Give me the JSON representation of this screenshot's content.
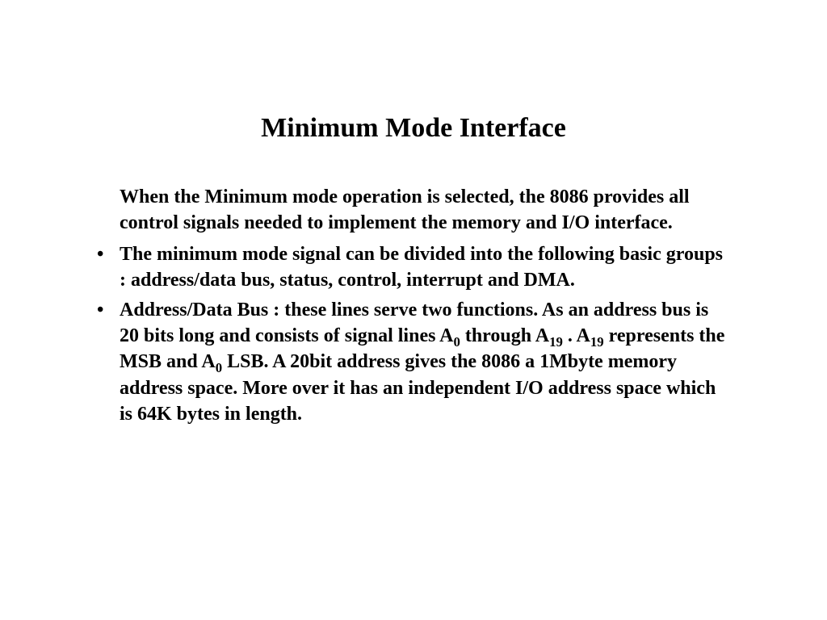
{
  "title": "Minimum Mode Interface",
  "intro": "When the Minimum mode operation is selected, the 8086 provides all control signals needed to implement the memory and I/O interface.",
  "bullets": [
    "The minimum mode signal can be divided into the following basic groups : address/data bus, status, control, interrupt and DMA.",
    "Address/Data Bus : these lines serve two functions. As an address bus is 20 bits long and consists of signal lines A"
  ],
  "b2_tail_parts": {
    "seg1": " through A",
    "seg2": " . A",
    "seg3": " represents the MSB and A",
    "seg4": "  LSB. A 20bit address gives the 8086 a 1Mbyte memory address space. More over it has an independent I/O address space which is 64K bytes in length."
  },
  "subs": {
    "zero": "0",
    "nineteen": "19"
  }
}
